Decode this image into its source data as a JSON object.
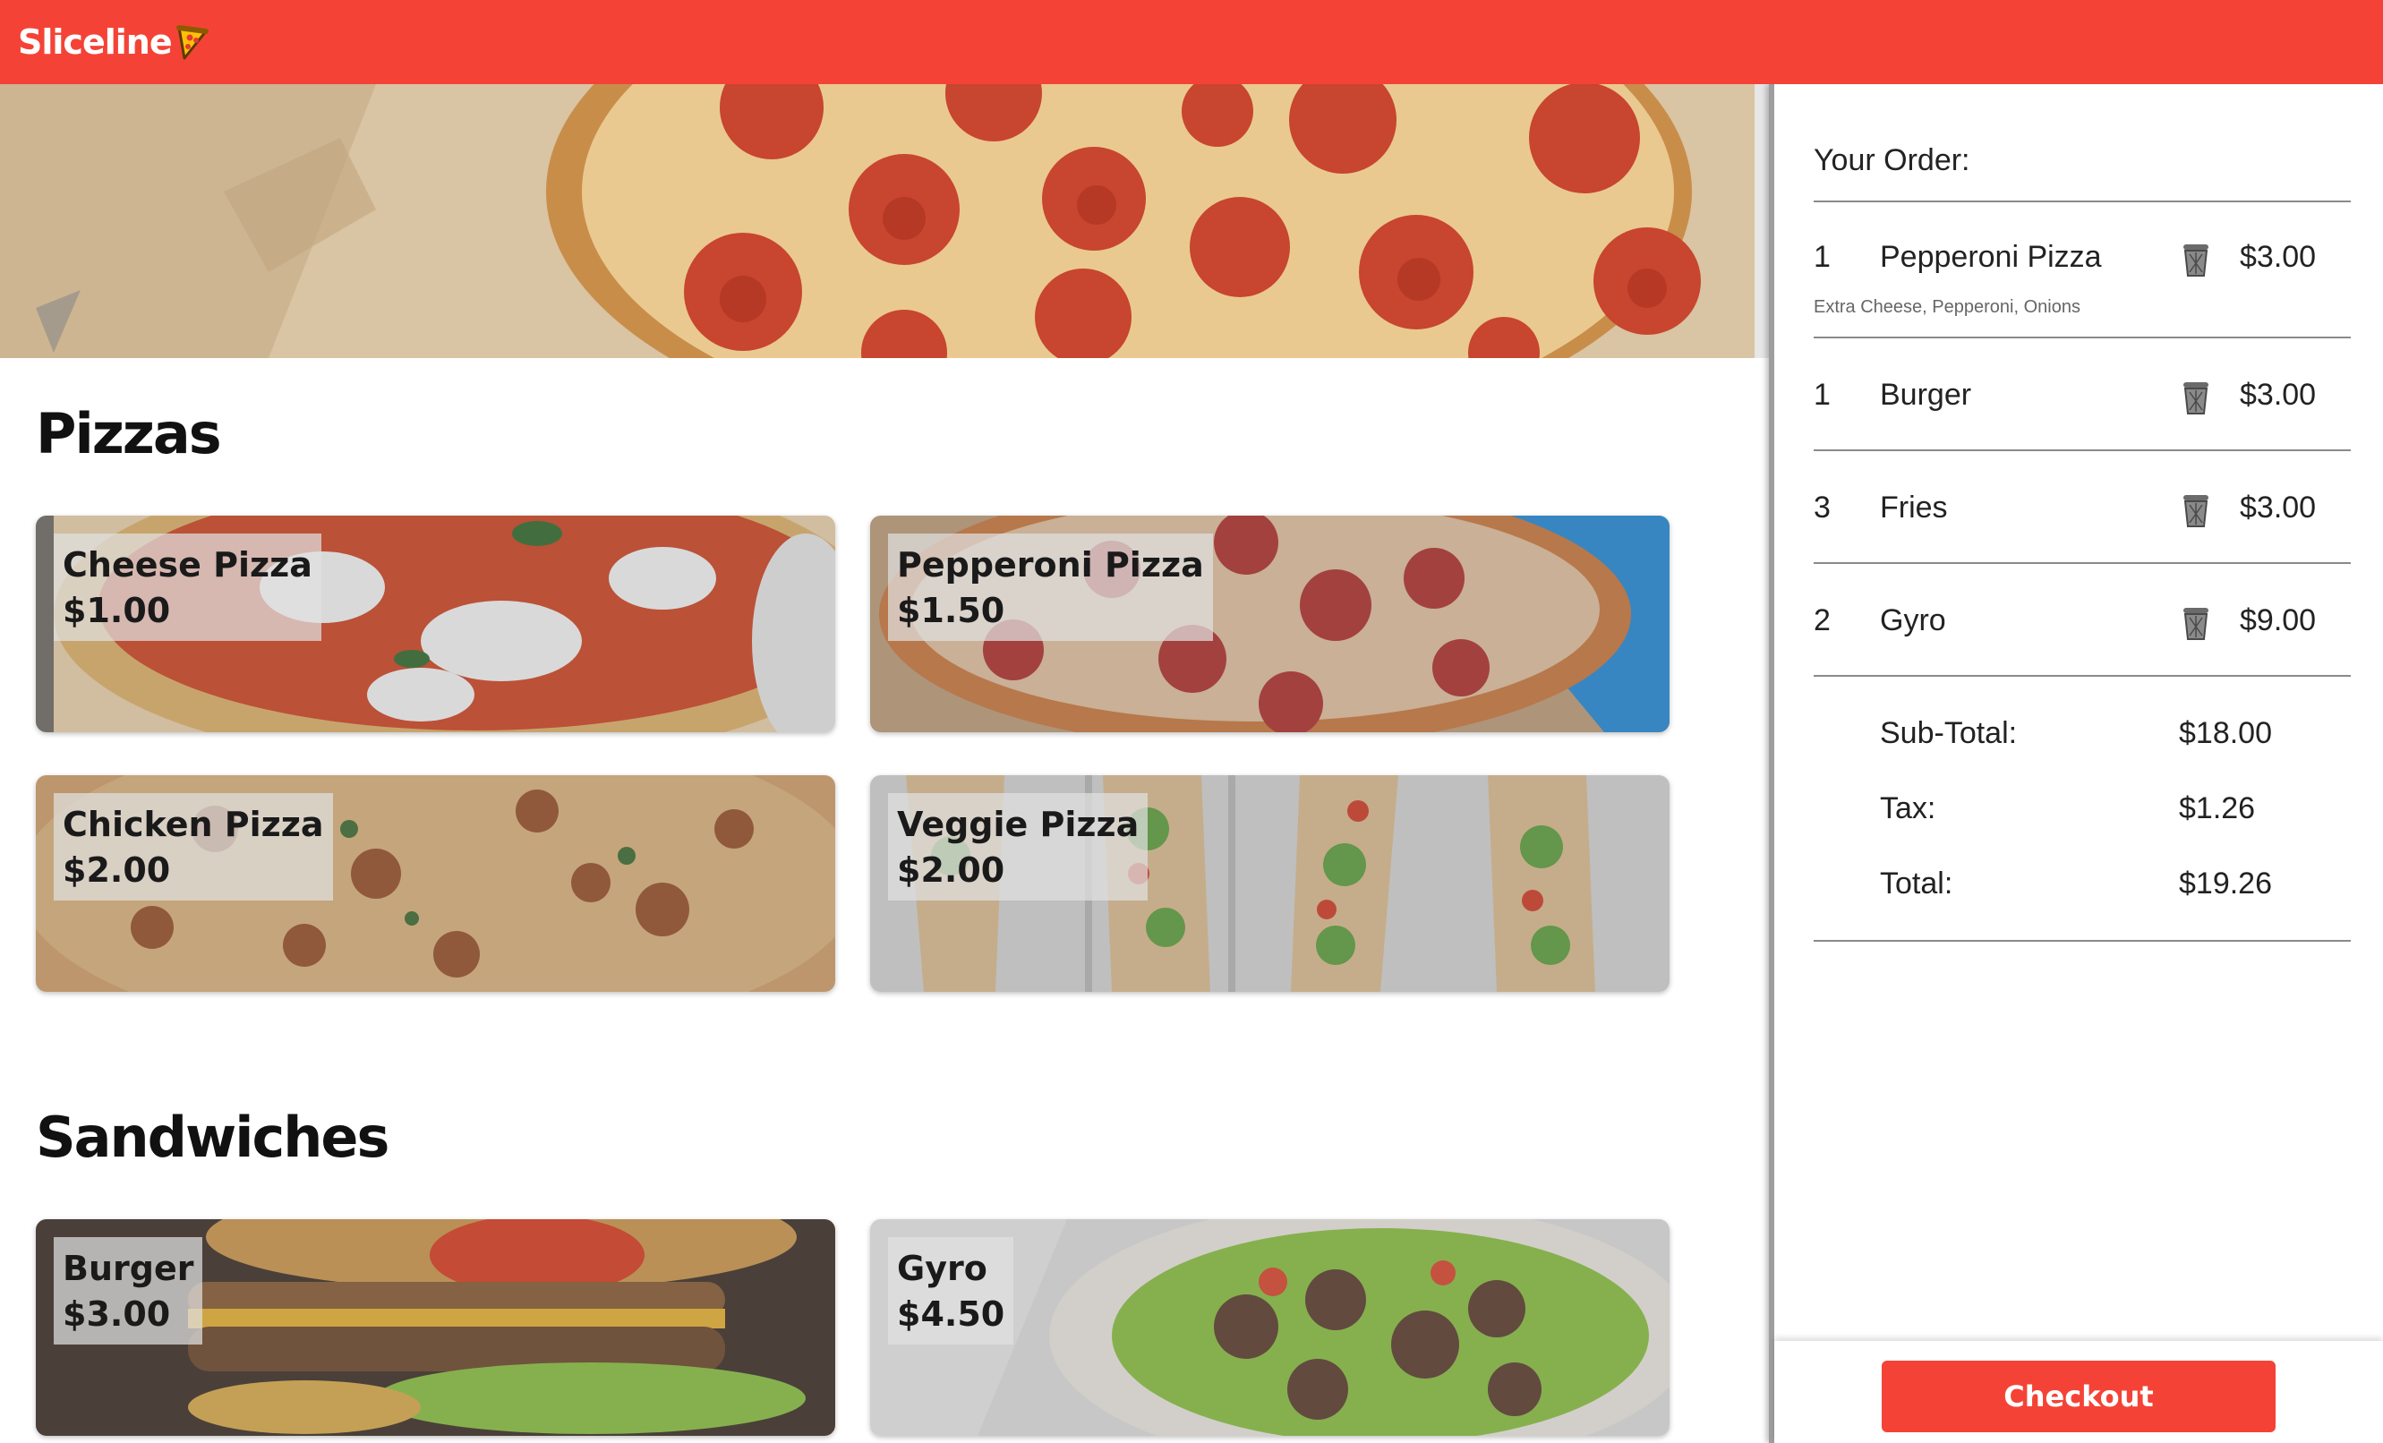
{
  "header": {
    "logo_text": "Sliceline"
  },
  "menu": {
    "sections": [
      {
        "title": "Pizzas"
      },
      {
        "title": "Sandwiches"
      }
    ],
    "items": [
      {
        "name": "Cheese Pizza",
        "price": "$1.00"
      },
      {
        "name": "Pepperoni Pizza",
        "price": "$1.50"
      },
      {
        "name": "Chicken Pizza",
        "price": "$2.00"
      },
      {
        "name": "Veggie Pizza",
        "price": "$2.00"
      },
      {
        "name": "Burger",
        "price": "$3.00"
      },
      {
        "name": "Gyro",
        "price": "$4.50"
      }
    ]
  },
  "order": {
    "title": "Your Order:",
    "lines": [
      {
        "qty": "1",
        "name": "Pepperoni Pizza",
        "price": "$3.00",
        "modifiers": "Extra Cheese, Pepperoni, Onions"
      },
      {
        "qty": "1",
        "name": "Burger",
        "price": "$3.00"
      },
      {
        "qty": "3",
        "name": "Fries",
        "price": "$3.00"
      },
      {
        "qty": "2",
        "name": "Gyro",
        "price": "$9.00"
      }
    ],
    "summary": {
      "subtotal_label": "Sub-Total:",
      "subtotal": "$18.00",
      "tax_label": "Tax:",
      "tax": "$1.26",
      "total_label": "Total:",
      "total": "$19.26"
    },
    "checkout_label": "Checkout"
  },
  "colors": {
    "brand": "#f44336"
  },
  "icons": {
    "logo": "pizza-slice-icon",
    "remove": "trash-icon"
  }
}
